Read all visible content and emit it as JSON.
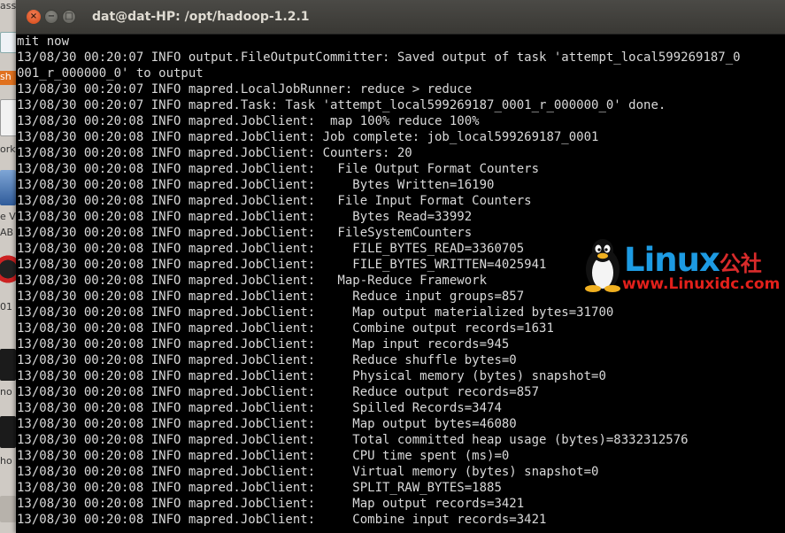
{
  "desktop": {
    "fragments": [
      "ass",
      "sh",
      "orks",
      "e V",
      "AB",
      "01",
      "no",
      "ho"
    ]
  },
  "window": {
    "title": "dat@dat-HP: /opt/hadoop-1.2.1",
    "close_label": "×",
    "minimize_label": "−",
    "maximize_label": "□"
  },
  "terminal": {
    "lines": [
      "mit now",
      "13/08/30 00:20:07 INFO output.FileOutputCommitter: Saved output of task 'attempt_local599269187_0",
      "001_r_000000_0' to output",
      "13/08/30 00:20:07 INFO mapred.LocalJobRunner: reduce > reduce",
      "13/08/30 00:20:07 INFO mapred.Task: Task 'attempt_local599269187_0001_r_000000_0' done.",
      "13/08/30 00:20:08 INFO mapred.JobClient:  map 100% reduce 100%",
      "13/08/30 00:20:08 INFO mapred.JobClient: Job complete: job_local599269187_0001",
      "13/08/30 00:20:08 INFO mapred.JobClient: Counters: 20",
      "13/08/30 00:20:08 INFO mapred.JobClient:   File Output Format Counters",
      "13/08/30 00:20:08 INFO mapred.JobClient:     Bytes Written=16190",
      "13/08/30 00:20:08 INFO mapred.JobClient:   File Input Format Counters",
      "13/08/30 00:20:08 INFO mapred.JobClient:     Bytes Read=33992",
      "13/08/30 00:20:08 INFO mapred.JobClient:   FileSystemCounters",
      "13/08/30 00:20:08 INFO mapred.JobClient:     FILE_BYTES_READ=3360705",
      "13/08/30 00:20:08 INFO mapred.JobClient:     FILE_BYTES_WRITTEN=4025941",
      "13/08/30 00:20:08 INFO mapred.JobClient:   Map-Reduce Framework",
      "13/08/30 00:20:08 INFO mapred.JobClient:     Reduce input groups=857",
      "13/08/30 00:20:08 INFO mapred.JobClient:     Map output materialized bytes=31700",
      "13/08/30 00:20:08 INFO mapred.JobClient:     Combine output records=1631",
      "13/08/30 00:20:08 INFO mapred.JobClient:     Map input records=945",
      "13/08/30 00:20:08 INFO mapred.JobClient:     Reduce shuffle bytes=0",
      "13/08/30 00:20:08 INFO mapred.JobClient:     Physical memory (bytes) snapshot=0",
      "13/08/30 00:20:08 INFO mapred.JobClient:     Reduce output records=857",
      "13/08/30 00:20:08 INFO mapred.JobClient:     Spilled Records=3474",
      "13/08/30 00:20:08 INFO mapred.JobClient:     Map output bytes=46080",
      "13/08/30 00:20:08 INFO mapred.JobClient:     Total committed heap usage (bytes)=8332312576",
      "13/08/30 00:20:08 INFO mapred.JobClient:     CPU time spent (ms)=0",
      "13/08/30 00:20:08 INFO mapred.JobClient:     Virtual memory (bytes) snapshot=0",
      "13/08/30 00:20:08 INFO mapred.JobClient:     SPLIT_RAW_BYTES=1885",
      "13/08/30 00:20:08 INFO mapred.JobClient:     Map output records=3421",
      "13/08/30 00:20:08 INFO mapred.JobClient:     Combine input records=3421"
    ]
  },
  "watermark": {
    "brand": "Linux",
    "brand_cn": "公社",
    "url": "www.Linuxidc.com"
  },
  "colors": {
    "terminal_bg": "#000000",
    "terminal_fg": "#d9d9d9",
    "titlebar": "#3c3b37",
    "close_button": "#e05a26",
    "watermark_blue": "#1d9be3",
    "watermark_red": "#e2201b"
  }
}
